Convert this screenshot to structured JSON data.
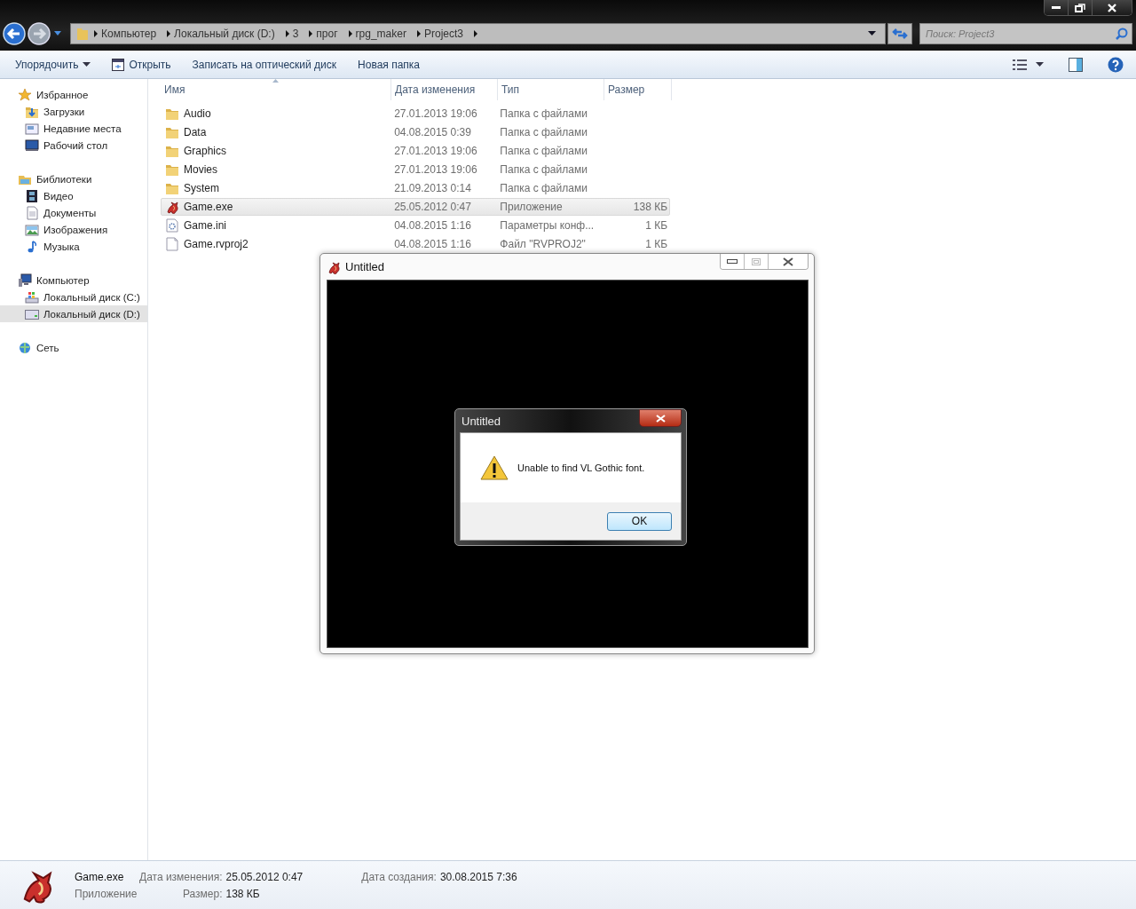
{
  "address_bar": {
    "crumbs": [
      "Компьютер",
      "Локальный диск (D:)",
      "3",
      "прог",
      "rpg_maker",
      "Project3"
    ]
  },
  "search": {
    "placeholder": "Поиск: Project3"
  },
  "toolbar": [
    {
      "label": "Упорядочить",
      "kind": "menu"
    },
    {
      "label": "Открыть",
      "kind": "icon"
    },
    {
      "label": "Записать на оптический диск",
      "kind": "plain"
    },
    {
      "label": "Новая папка",
      "kind": "plain"
    }
  ],
  "sidebar": [
    {
      "label": "Избранное",
      "kind": "star",
      "children": [
        {
          "label": "Загрузки",
          "kind": "downloads",
          "selected": false
        },
        {
          "label": "Недавние места",
          "kind": "recent",
          "selected": false
        },
        {
          "label": "Рабочий стол",
          "kind": "desktop",
          "selected": false
        }
      ]
    },
    {
      "label": "Библиотеки",
      "kind": "library",
      "children": [
        {
          "label": "Видео",
          "kind": "video",
          "selected": false
        },
        {
          "label": "Документы",
          "kind": "docs",
          "selected": false
        },
        {
          "label": "Изображения",
          "kind": "images",
          "selected": false
        },
        {
          "label": "Музыка",
          "kind": "music",
          "selected": false
        }
      ]
    },
    {
      "label": "Компьютер",
      "kind": "computer",
      "children": [
        {
          "label": "Локальный диск (C:)",
          "kind": "sysdrive",
          "selected": false
        },
        {
          "label": "Локальный диск (D:)",
          "kind": "drive",
          "selected": true
        }
      ]
    },
    {
      "label": "Сеть",
      "kind": "network"
    }
  ],
  "table": {
    "columns": [
      "Имя",
      "Дата изменения",
      "Тип",
      "Размер"
    ],
    "rows": [
      {
        "name": "Audio",
        "date": "27.01.2013 19:06",
        "type": "Папка с файлами",
        "kind": "folder",
        "selected": false
      },
      {
        "name": "Data",
        "date": "04.08.2015 0:39",
        "type": "Папка с файлами",
        "kind": "folder",
        "selected": false
      },
      {
        "name": "Graphics",
        "date": "27.01.2013 19:06",
        "type": "Папка с файлами",
        "kind": "folder",
        "selected": false
      },
      {
        "name": "Movies",
        "date": "27.01.2013 19:06",
        "type": "Папка с файлами",
        "kind": "folder",
        "selected": false
      },
      {
        "name": "System",
        "date": "21.09.2013 0:14",
        "type": "Папка с файлами",
        "kind": "folder",
        "selected": false
      },
      {
        "name": "Game.exe",
        "date": "25.05.2012 0:47",
        "type": "Приложение",
        "size": "138 КБ",
        "kind": "exe",
        "selected": true
      },
      {
        "name": "Game.ini",
        "date": "04.08.2015 1:16",
        "type": "Параметры конф...",
        "size": "1 КБ",
        "kind": "ini",
        "selected": false
      },
      {
        "name": "Game.rvproj2",
        "date": "04.08.2015 1:16",
        "type": "Файл \"RVPROJ2\"",
        "size": "1 КБ",
        "kind": "file",
        "selected": false
      }
    ]
  },
  "game_window": {
    "title": "Untitled"
  },
  "dialog": {
    "title": "Untitled",
    "message": "Unable to find VL Gothic font.",
    "button": "OK"
  },
  "details": {
    "name": "Game.exe",
    "type": "Приложение",
    "fields": [
      {
        "label": "Дата изменения:",
        "value": "25.05.2012 0:47"
      },
      {
        "label": "Размер:",
        "value": "138 КБ"
      },
      {
        "label": "Дата создания:",
        "value": "30.08.2015 7:36"
      }
    ]
  }
}
